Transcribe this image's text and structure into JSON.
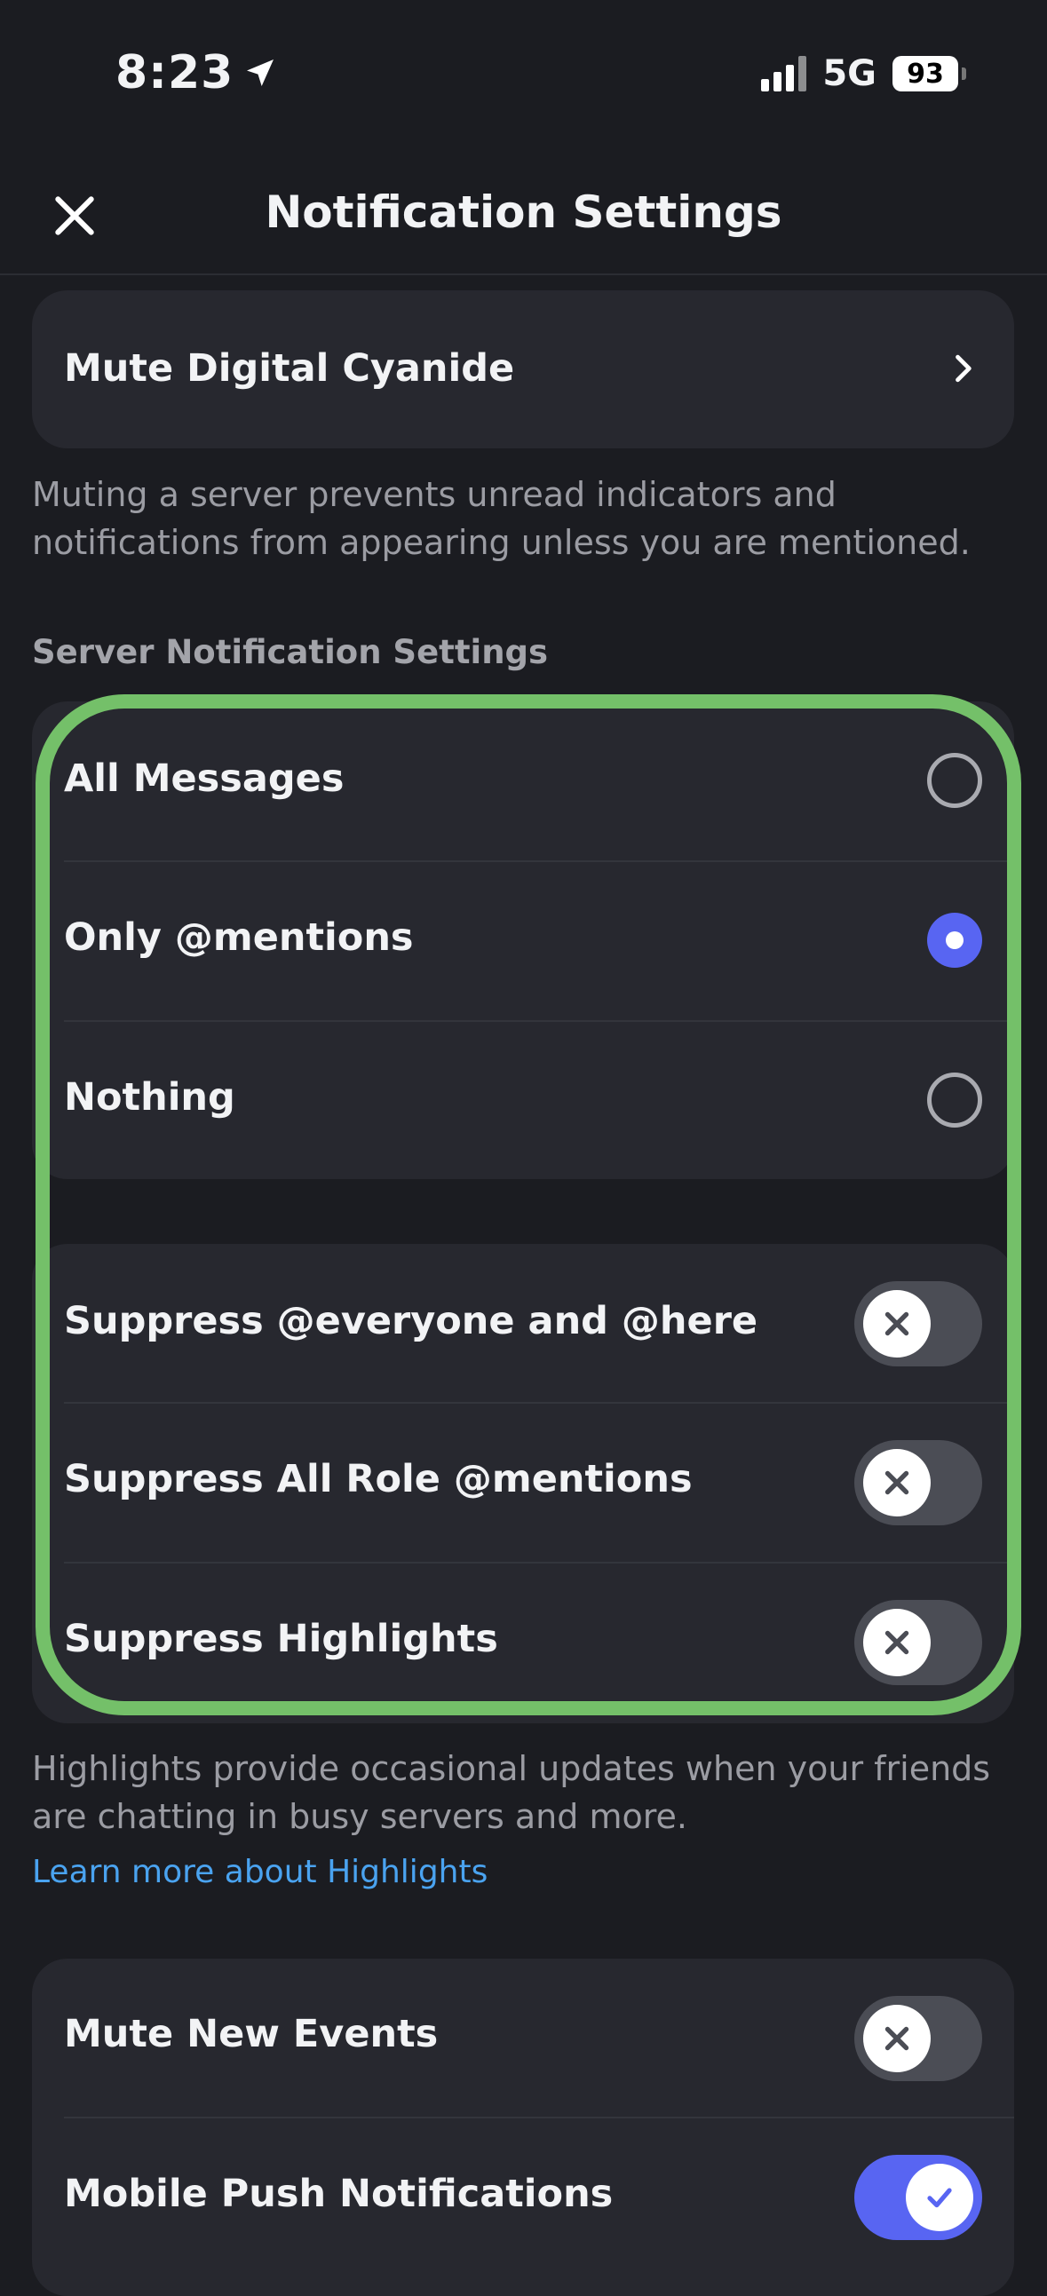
{
  "status_bar": {
    "time": "8:23",
    "network": "5G",
    "battery": "93"
  },
  "header": {
    "title": "Notification Settings"
  },
  "mute_server": {
    "label": "Mute Digital Cyanide",
    "description": "Muting a server prevents unread indicators and notifications from appearing unless you are mentioned."
  },
  "server_notifications": {
    "section_title": "Server Notification Settings",
    "options": [
      {
        "label": "All Messages",
        "selected": false
      },
      {
        "label": "Only @mentions",
        "selected": true
      },
      {
        "label": "Nothing",
        "selected": false
      }
    ]
  },
  "suppress": {
    "items": [
      {
        "label": "Suppress @everyone and @here",
        "on": false
      },
      {
        "label": "Suppress All Role @mentions",
        "on": false
      },
      {
        "label": "Suppress Highlights",
        "on": false
      }
    ],
    "description": "Highlights provide occasional updates when your friends are chatting in busy servers and more.",
    "learn_more": "Learn more about Highlights"
  },
  "other": {
    "items": [
      {
        "label": "Mute New Events",
        "on": false
      },
      {
        "label": "Mobile Push Notifications",
        "on": true
      }
    ]
  },
  "colors": {
    "accent": "#5865f2",
    "annotation": "#74c069",
    "link": "#4aa3f0",
    "background": "#1b1c21",
    "card": "#27282f"
  }
}
